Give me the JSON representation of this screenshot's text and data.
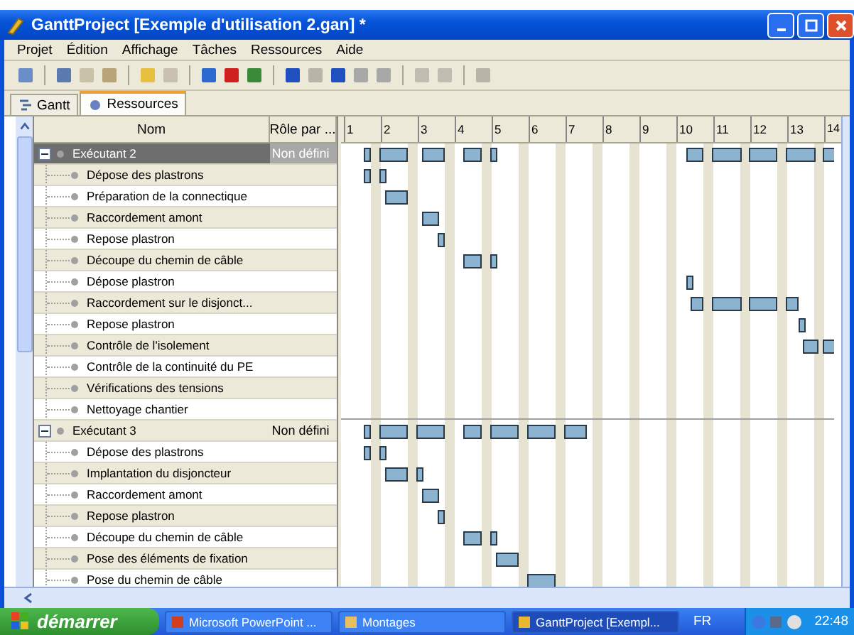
{
  "window": {
    "title": "GanttProject [Exemple d'utilisation 2.gan] *"
  },
  "menu": [
    "Projet",
    "Édition",
    "Affichage",
    "Tâches",
    "Ressources",
    "Aide"
  ],
  "tabs": [
    {
      "label": "Gantt",
      "selected": false
    },
    {
      "label": "Ressources",
      "selected": true
    }
  ],
  "table": {
    "columns": [
      "Nom",
      "Rôle par ..."
    ],
    "resources": [
      {
        "name": "Exécutant 2",
        "role": "Non défini",
        "expanded": true,
        "selected": true,
        "children": [
          {
            "name": "Dépose des plastrons"
          },
          {
            "name": "Préparation de la connectique"
          },
          {
            "name": "Raccordement amont"
          },
          {
            "name": "Repose plastron"
          },
          {
            "name": "Découpe du chemin de câble"
          },
          {
            "name": "Dépose plastron"
          },
          {
            "name": "Raccordement sur le disjonct..."
          },
          {
            "name": "Repose plastron"
          },
          {
            "name": "Contrôle de l'isolement"
          },
          {
            "name": "Contrôle de la continuité  du PE"
          },
          {
            "name": "Vérifications des tensions"
          },
          {
            "name": "Nettoyage chantier"
          }
        ]
      },
      {
        "name": "Exécutant 3",
        "role": "Non défini",
        "expanded": true,
        "selected": false,
        "children": [
          {
            "name": "Dépose des plastrons"
          },
          {
            "name": "Implantation du disjoncteur"
          },
          {
            "name": "Raccordement amont"
          },
          {
            "name": "Repose plastron"
          },
          {
            "name": "Découpe du chemin de câble"
          },
          {
            "name": "Pose des éléments de fixation"
          },
          {
            "name": "Pose du chemin de câble"
          }
        ]
      }
    ]
  },
  "timeline": {
    "days": [
      "1",
      "2",
      "3",
      "4",
      "5",
      "6",
      "7",
      "8",
      "9",
      "10",
      "11",
      "12",
      "13",
      "14"
    ]
  },
  "taskbar": {
    "start": "démarrer",
    "items": [
      {
        "label": "Microsoft PowerPoint ...",
        "selected": false
      },
      {
        "label": "Montages",
        "selected": false
      },
      {
        "label": "GanttProject [Exempl...",
        "selected": true
      }
    ],
    "language": "FR",
    "clock": "22:48"
  }
}
